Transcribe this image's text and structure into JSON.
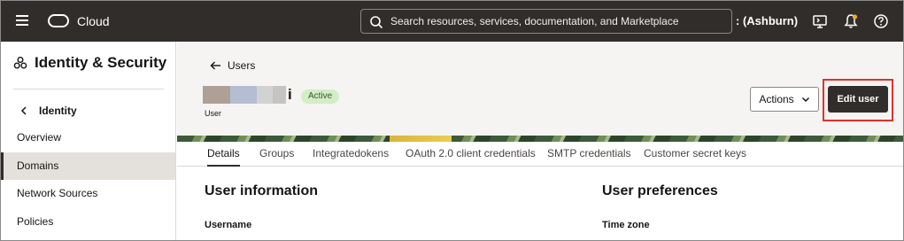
{
  "topbar": {
    "brand": "Cloud",
    "search_placeholder": "Search resources, services, documentation, and Marketplace",
    "region": ": (Ashburn)"
  },
  "sidebar": {
    "title": "Identity & Security",
    "back_label": "Identity",
    "items": [
      {
        "label": "Overview"
      },
      {
        "label": "Domains"
      },
      {
        "label": "Network Sources"
      },
      {
        "label": "Policies"
      }
    ]
  },
  "header": {
    "back_label": "Users",
    "name_suffix": "i",
    "status": "Active",
    "caption": "User",
    "actions_label": "Actions",
    "edit_label": "Edit user"
  },
  "tabs": [
    {
      "label": "Details"
    },
    {
      "label": "Groups"
    },
    {
      "label": "Integratedokens"
    },
    {
      "label": "OAuth 2.0 client credentials"
    },
    {
      "label": "SMTP credentials"
    },
    {
      "label": "Customer secret keys"
    }
  ],
  "content": {
    "user_info_title": "User information",
    "username_label": "Username",
    "preferences_title": "User preferences",
    "timezone_label": "Time zone"
  },
  "colors": {
    "topbar": "#312d2a",
    "active_badge": "#d4ecc9",
    "highlight": "#e0312f"
  },
  "icons": [
    "menu-icon",
    "oracle-logo-icon",
    "search-icon",
    "cloud-shell-icon",
    "bell-icon",
    "help-icon",
    "identity-security-icon",
    "chevron-left-icon",
    "arrow-left-icon",
    "chevron-down-icon"
  ]
}
